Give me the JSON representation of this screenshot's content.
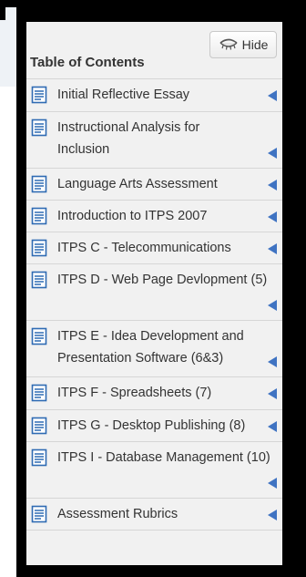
{
  "toc": {
    "title": "Table of Contents",
    "hide_label": "Hide",
    "items": [
      {
        "label": "Initial Reflective Essay"
      },
      {
        "label": "Instructional Analysis for Inclusion"
      },
      {
        "label": "Language Arts Assessment"
      },
      {
        "label": "Introduction to ITPS 2007"
      },
      {
        "label": "ITPS C - Telecommunications"
      },
      {
        "label": "ITPS D - Web Page Devlopment (5)"
      },
      {
        "label": "ITPS E - Idea Development and Presentation Software (6&3)"
      },
      {
        "label": "ITPS F - Spreadsheets (7)"
      },
      {
        "label": "ITPS G - Desktop Publishing (8)"
      },
      {
        "label": "ITPS I - Database Management (10)"
      },
      {
        "label": "Assessment Rubrics"
      }
    ]
  },
  "colors": {
    "panel_bg": "#f1f1f1",
    "frame": "#000000",
    "icon_blue": "#2f6bb3",
    "arrow_blue": "#3f73c2"
  },
  "icons": {
    "item_icon": "document-icon",
    "item_arrow": "triangle-left-icon",
    "hide_icon": "eye-closed-icon"
  }
}
